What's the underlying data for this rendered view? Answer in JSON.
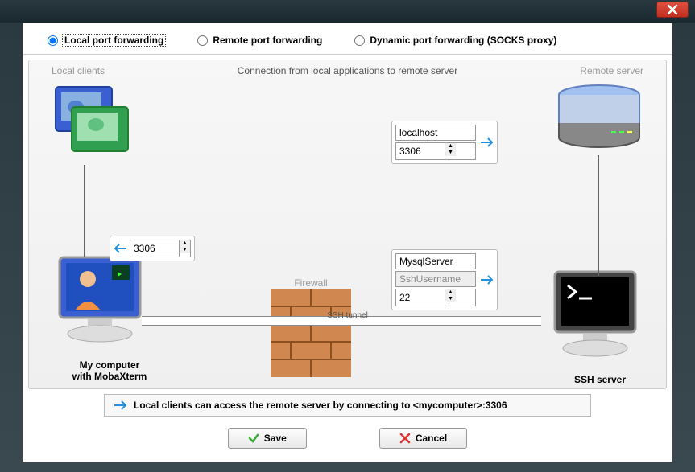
{
  "radios": {
    "local": "Local port forwarding",
    "remote": "Remote port forwarding",
    "dynamic": "Dynamic port forwarding (SOCKS proxy)"
  },
  "labels": {
    "local_clients": "Local clients",
    "remote_server": "Remote server",
    "connection_title": "Connection from local applications to remote server",
    "firewall": "Firewall",
    "ssh_tunnel": "SSH tunnel",
    "my_computer_l1": "My computer",
    "my_computer_l2": "with MobaXterm",
    "ssh_server": "SSH server"
  },
  "fields": {
    "local_port": "3306",
    "remote_host": "localhost",
    "remote_port": "3306",
    "ssh_server": "MysqlServer",
    "ssh_user": "SshUsername",
    "ssh_port": "22"
  },
  "status": "Local clients can access the remote server by connecting to <mycomputer>:3306",
  "buttons": {
    "save": "Save",
    "cancel": "Cancel"
  }
}
